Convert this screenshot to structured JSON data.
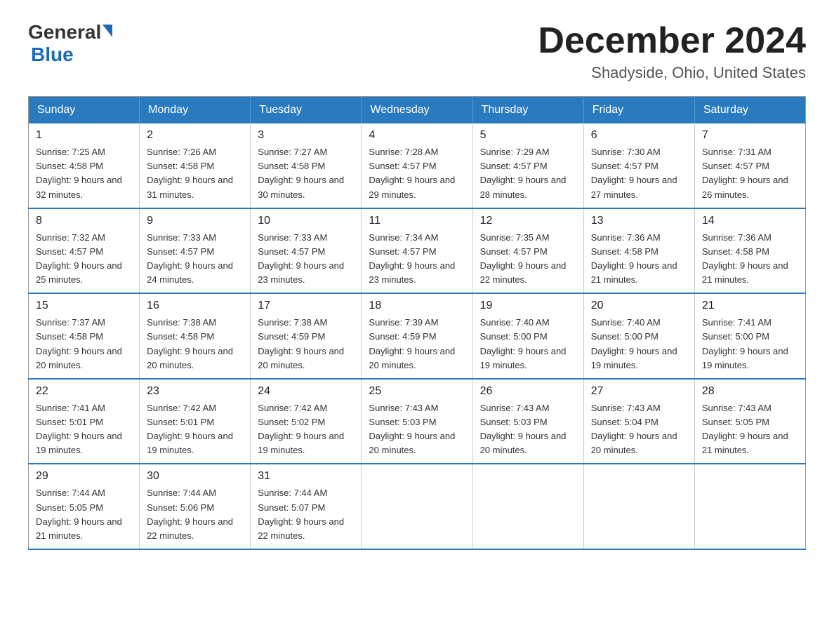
{
  "header": {
    "logo_general": "General",
    "logo_blue": "Blue",
    "month_title": "December 2024",
    "subtitle": "Shadyside, Ohio, United States"
  },
  "days_of_week": [
    "Sunday",
    "Monday",
    "Tuesday",
    "Wednesday",
    "Thursday",
    "Friday",
    "Saturday"
  ],
  "weeks": [
    [
      {
        "day": "1",
        "sunrise": "7:25 AM",
        "sunset": "4:58 PM",
        "daylight": "9 hours and 32 minutes."
      },
      {
        "day": "2",
        "sunrise": "7:26 AM",
        "sunset": "4:58 PM",
        "daylight": "9 hours and 31 minutes."
      },
      {
        "day": "3",
        "sunrise": "7:27 AM",
        "sunset": "4:58 PM",
        "daylight": "9 hours and 30 minutes."
      },
      {
        "day": "4",
        "sunrise": "7:28 AM",
        "sunset": "4:57 PM",
        "daylight": "9 hours and 29 minutes."
      },
      {
        "day": "5",
        "sunrise": "7:29 AM",
        "sunset": "4:57 PM",
        "daylight": "9 hours and 28 minutes."
      },
      {
        "day": "6",
        "sunrise": "7:30 AM",
        "sunset": "4:57 PM",
        "daylight": "9 hours and 27 minutes."
      },
      {
        "day": "7",
        "sunrise": "7:31 AM",
        "sunset": "4:57 PM",
        "daylight": "9 hours and 26 minutes."
      }
    ],
    [
      {
        "day": "8",
        "sunrise": "7:32 AM",
        "sunset": "4:57 PM",
        "daylight": "9 hours and 25 minutes."
      },
      {
        "day": "9",
        "sunrise": "7:33 AM",
        "sunset": "4:57 PM",
        "daylight": "9 hours and 24 minutes."
      },
      {
        "day": "10",
        "sunrise": "7:33 AM",
        "sunset": "4:57 PM",
        "daylight": "9 hours and 23 minutes."
      },
      {
        "day": "11",
        "sunrise": "7:34 AM",
        "sunset": "4:57 PM",
        "daylight": "9 hours and 23 minutes."
      },
      {
        "day": "12",
        "sunrise": "7:35 AM",
        "sunset": "4:57 PM",
        "daylight": "9 hours and 22 minutes."
      },
      {
        "day": "13",
        "sunrise": "7:36 AM",
        "sunset": "4:58 PM",
        "daylight": "9 hours and 21 minutes."
      },
      {
        "day": "14",
        "sunrise": "7:36 AM",
        "sunset": "4:58 PM",
        "daylight": "9 hours and 21 minutes."
      }
    ],
    [
      {
        "day": "15",
        "sunrise": "7:37 AM",
        "sunset": "4:58 PM",
        "daylight": "9 hours and 20 minutes."
      },
      {
        "day": "16",
        "sunrise": "7:38 AM",
        "sunset": "4:58 PM",
        "daylight": "9 hours and 20 minutes."
      },
      {
        "day": "17",
        "sunrise": "7:38 AM",
        "sunset": "4:59 PM",
        "daylight": "9 hours and 20 minutes."
      },
      {
        "day": "18",
        "sunrise": "7:39 AM",
        "sunset": "4:59 PM",
        "daylight": "9 hours and 20 minutes."
      },
      {
        "day": "19",
        "sunrise": "7:40 AM",
        "sunset": "5:00 PM",
        "daylight": "9 hours and 19 minutes."
      },
      {
        "day": "20",
        "sunrise": "7:40 AM",
        "sunset": "5:00 PM",
        "daylight": "9 hours and 19 minutes."
      },
      {
        "day": "21",
        "sunrise": "7:41 AM",
        "sunset": "5:00 PM",
        "daylight": "9 hours and 19 minutes."
      }
    ],
    [
      {
        "day": "22",
        "sunrise": "7:41 AM",
        "sunset": "5:01 PM",
        "daylight": "9 hours and 19 minutes."
      },
      {
        "day": "23",
        "sunrise": "7:42 AM",
        "sunset": "5:01 PM",
        "daylight": "9 hours and 19 minutes."
      },
      {
        "day": "24",
        "sunrise": "7:42 AM",
        "sunset": "5:02 PM",
        "daylight": "9 hours and 19 minutes."
      },
      {
        "day": "25",
        "sunrise": "7:43 AM",
        "sunset": "5:03 PM",
        "daylight": "9 hours and 20 minutes."
      },
      {
        "day": "26",
        "sunrise": "7:43 AM",
        "sunset": "5:03 PM",
        "daylight": "9 hours and 20 minutes."
      },
      {
        "day": "27",
        "sunrise": "7:43 AM",
        "sunset": "5:04 PM",
        "daylight": "9 hours and 20 minutes."
      },
      {
        "day": "28",
        "sunrise": "7:43 AM",
        "sunset": "5:05 PM",
        "daylight": "9 hours and 21 minutes."
      }
    ],
    [
      {
        "day": "29",
        "sunrise": "7:44 AM",
        "sunset": "5:05 PM",
        "daylight": "9 hours and 21 minutes."
      },
      {
        "day": "30",
        "sunrise": "7:44 AM",
        "sunset": "5:06 PM",
        "daylight": "9 hours and 22 minutes."
      },
      {
        "day": "31",
        "sunrise": "7:44 AM",
        "sunset": "5:07 PM",
        "daylight": "9 hours and 22 minutes."
      },
      null,
      null,
      null,
      null
    ]
  ],
  "colors": {
    "header_bg": "#2a7abf",
    "header_text": "#ffffff",
    "border_accent": "#2a7abf"
  }
}
